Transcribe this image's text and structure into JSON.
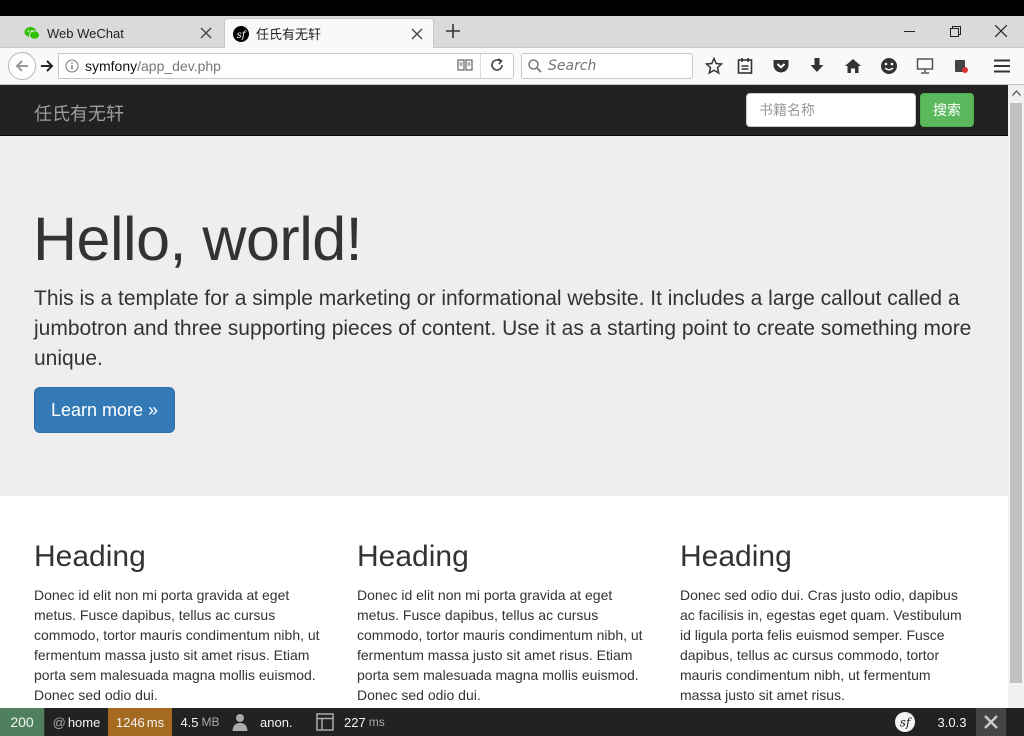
{
  "browser": {
    "tabs": [
      {
        "title": "Web WeChat",
        "favicon": "wechat-icon",
        "active": false
      },
      {
        "title": "任氏有无轩",
        "favicon": "symfony-icon",
        "active": true
      }
    ],
    "url_host": "symfony",
    "url_path": "/app_dev.php",
    "search_placeholder": "Search"
  },
  "site": {
    "brand": "任氏有无轩",
    "search_placeholder": "书籍名称",
    "search_button": "搜索",
    "search_button_color": "#5cb85c"
  },
  "jumbotron": {
    "title": "Hello, world!",
    "text": "This is a template for a simple marketing or informational website. It includes a large callout called a jumbotron and three supporting pieces of content. Use it as a starting point to create something more unique.",
    "button": "Learn more »",
    "button_color": "#337ab7"
  },
  "columns": [
    {
      "heading": "Heading",
      "text": "Donec id elit non mi porta gravida at eget metus. Fusce dapibus, tellus ac cursus commodo, tortor mauris condimentum nibh, ut fermentum massa justo sit amet risus. Etiam porta sem malesuada magna mollis euismod. Donec sed odio dui."
    },
    {
      "heading": "Heading",
      "text": "Donec id elit non mi porta gravida at eget metus. Fusce dapibus, tellus ac cursus commodo, tortor mauris condimentum nibh, ut fermentum massa justo sit amet risus. Etiam porta sem malesuada magna mollis euismod. Donec sed odio dui."
    },
    {
      "heading": "Heading",
      "text": "Donec sed odio dui. Cras justo odio, dapibus ac facilisis in, egestas eget quam. Vestibulum id ligula porta felis euismod semper. Fusce dapibus, tellus ac cursus commodo, tortor mauris condimentum nibh, ut fermentum massa justo sit amet risus."
    }
  ],
  "profiler": {
    "status": "200",
    "route_prefix": "@",
    "route": "home",
    "time": "1246",
    "time_unit": "ms",
    "memory": "4.5",
    "memory_unit": "MB",
    "user": "anon.",
    "db_time": "227",
    "db_unit": "ms",
    "version": "3.0.3",
    "status_color": "#4f805d",
    "time_color": "#a46a1f"
  }
}
